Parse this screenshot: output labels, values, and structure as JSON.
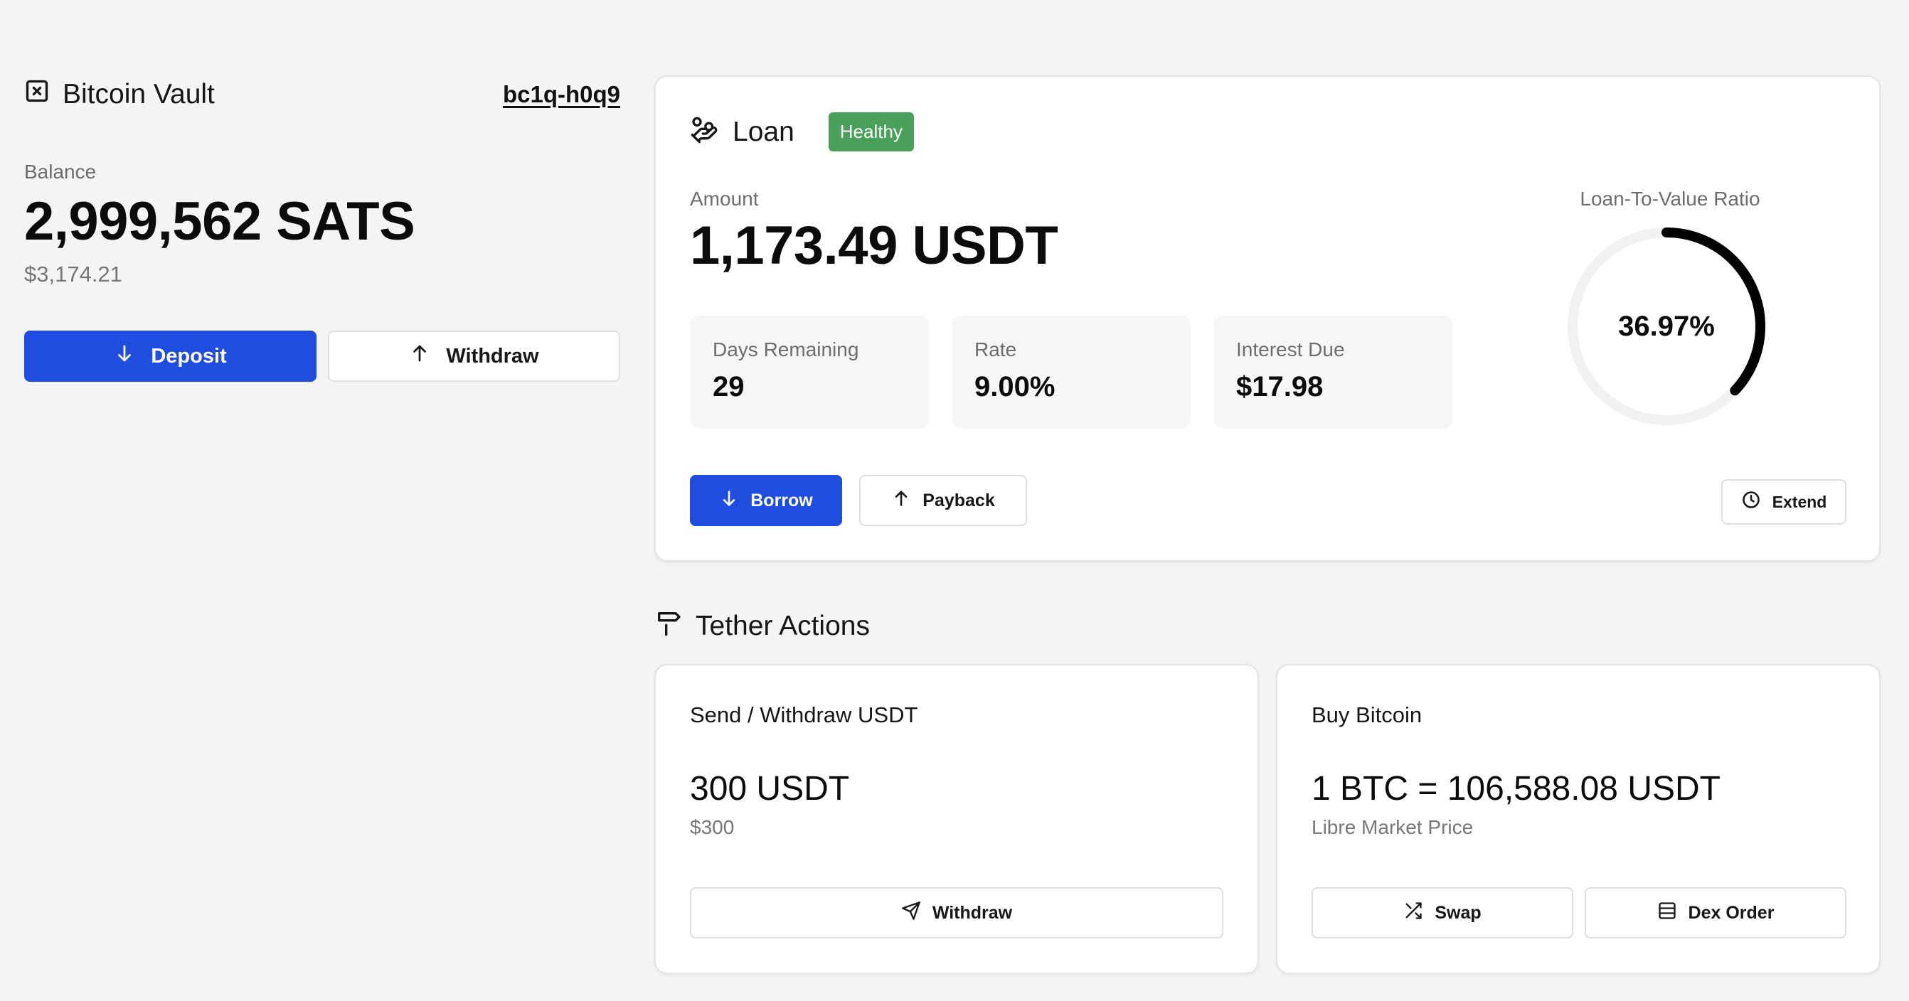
{
  "vault": {
    "icon": "square-x-icon",
    "title": "Bitcoin Vault",
    "address": "bc1q-h0q9",
    "balance_label": "Balance",
    "balance_value": "2,999,562 SATS",
    "balance_usd": "$3,174.21",
    "deposit_label": "Deposit",
    "withdraw_label": "Withdraw"
  },
  "loan": {
    "icon": "hand-coins-icon",
    "title": "Loan",
    "status": "Healthy",
    "status_color": "#4aa05a",
    "amount_label": "Amount",
    "amount_value": "1,173.49 USDT",
    "stats": [
      {
        "label": "Days Remaining",
        "value": "29"
      },
      {
        "label": "Rate",
        "value": "9.00%"
      },
      {
        "label": "Interest Due",
        "value": "$17.98"
      }
    ],
    "ltv_label": "Loan-To-Value Ratio",
    "ltv_value": "36.97%",
    "ltv_fraction": 0.3697,
    "borrow_label": "Borrow",
    "payback_label": "Payback",
    "extend_label": "Extend"
  },
  "tether": {
    "icon": "signpost-icon",
    "section_title": "Tether Actions",
    "send": {
      "title": "Send / Withdraw USDT",
      "amount": "300 USDT",
      "amount_usd": "$300",
      "withdraw_label": "Withdraw"
    },
    "buy": {
      "title": "Buy Bitcoin",
      "price": "1 BTC = 106,588.08 USDT",
      "price_source": "Libre Market Price",
      "swap_label": "Swap",
      "dex_label": "Dex Order"
    }
  },
  "colors": {
    "primary": "#1e4de0",
    "background": "#f4f4f4",
    "card": "#ffffff",
    "healthy": "#4aa05a"
  }
}
